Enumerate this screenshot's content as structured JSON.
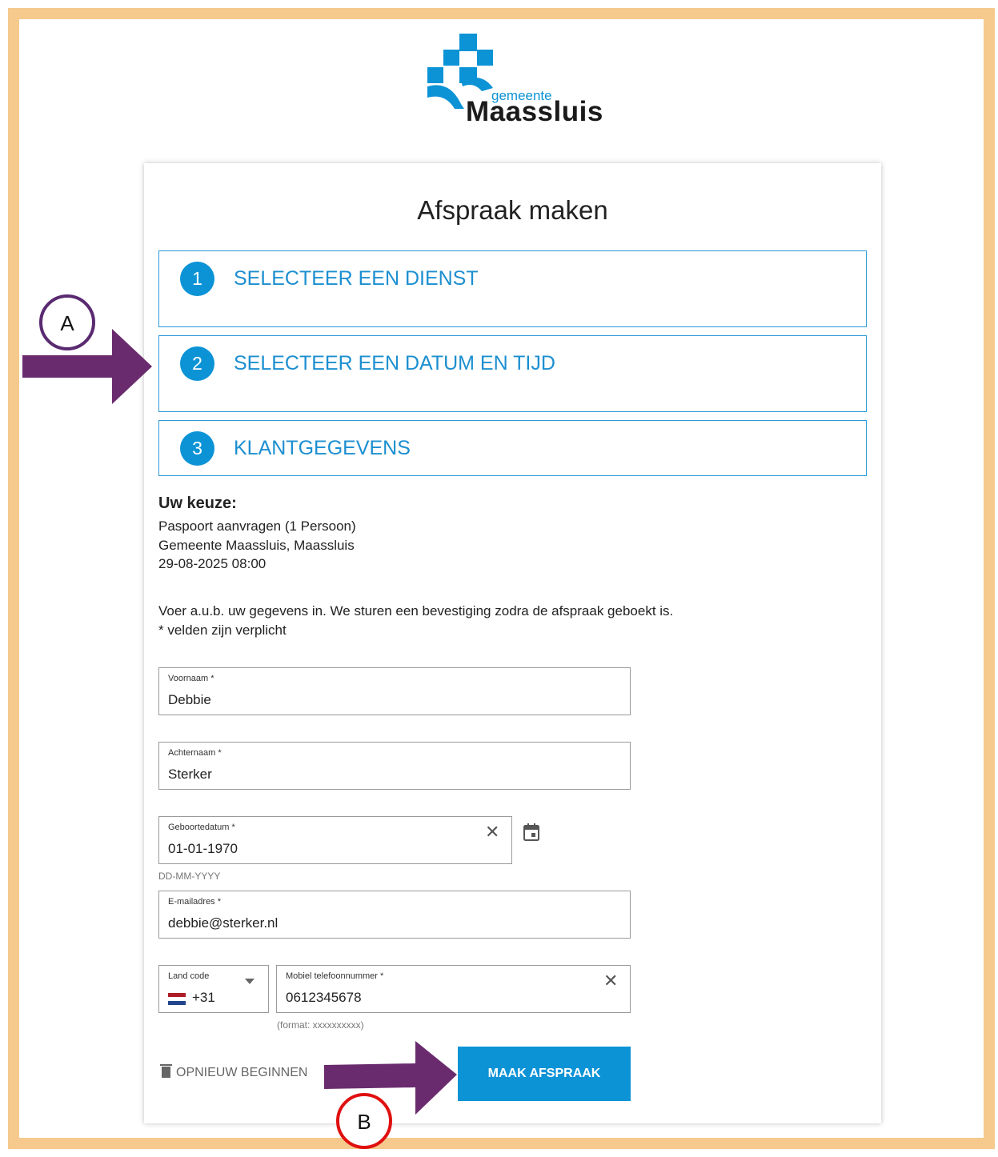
{
  "logo": {
    "small": "gemeente",
    "main": "Maassluis"
  },
  "page_title": "Afspraak maken",
  "steps": [
    {
      "num": "1",
      "label": "SELECTEER EEN DIENST"
    },
    {
      "num": "2",
      "label": "SELECTEER EEN DATUM EN TIJD"
    },
    {
      "num": "3",
      "label": "KLANTGEGEVENS"
    }
  ],
  "choice": {
    "heading": "Uw keuze:",
    "service": "Paspoort aanvragen (1 Persoon)",
    "location": "Gemeente Maassluis, Maassluis",
    "datetime": "29-08-2025 08:00"
  },
  "intro": {
    "line1": "Voer a.u.b. uw gegevens in. We sturen een bevestiging zodra de afspraak geboekt is.",
    "line2": "* velden zijn verplicht"
  },
  "form": {
    "firstname": {
      "label": "Voornaam *",
      "value": "Debbie"
    },
    "lastname": {
      "label": "Achternaam *",
      "value": "Sterker"
    },
    "birthdate": {
      "label": "Geboortedatum *",
      "value": "01-01-1970",
      "hint": "DD-MM-YYYY"
    },
    "email": {
      "label": "E-mailadres *",
      "value": "debbie@sterker.nl"
    },
    "country_code": {
      "label": "Land code",
      "value": "+31"
    },
    "phone": {
      "label": "Mobiel telefoonnummer *",
      "value": "0612345678",
      "hint": "(format: xxxxxxxxxx)"
    }
  },
  "actions": {
    "reset": "OPNIEUW BEGINNEN",
    "submit": "MAAK AFSPRAAK"
  },
  "annotations": {
    "a": "A",
    "b": "B"
  },
  "colors": {
    "accent": "#0b93d6",
    "frame": "#f6c98c",
    "arrow": "#6a2b6e",
    "marker_a": "#5a2a70",
    "marker_b": "#e01010"
  }
}
